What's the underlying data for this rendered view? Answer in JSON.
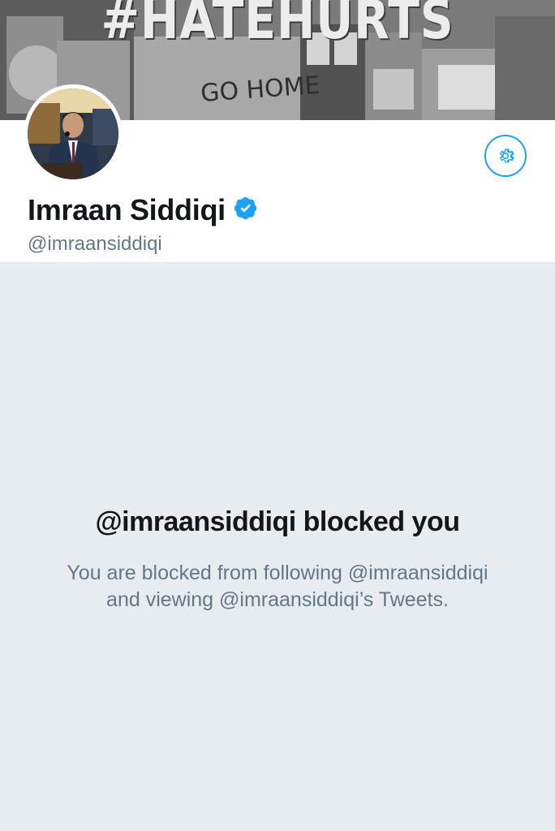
{
  "banner": {
    "hashtag": "#HATEHURTS",
    "graffiti_text": "GO HOME",
    "icon": "banner-image"
  },
  "profile": {
    "display_name": "Imraan Siddiqi",
    "handle": "@imraansiddiqi",
    "verified": true,
    "avatar_icon": "avatar-photo"
  },
  "actions": {
    "settings_icon": "gear-icon"
  },
  "blocked": {
    "title": "@imraansiddiqi blocked you",
    "line1": "You are blocked from following @imraansiddiqi",
    "line2": "and viewing @imraansiddiqi’s Tweets."
  },
  "colors": {
    "accent": "#1da1f2",
    "background": "#e6ecf0",
    "text_primary": "#14171a",
    "text_secondary": "#657786"
  }
}
